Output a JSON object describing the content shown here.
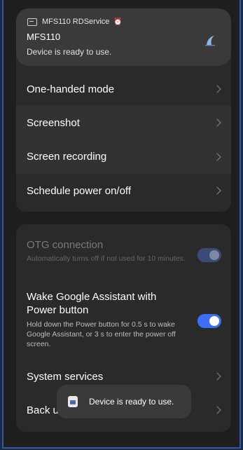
{
  "notification": {
    "app_name": "MFS110 RDService",
    "title": "MFS110",
    "message": "Device is ready to use."
  },
  "card1": {
    "items": [
      {
        "label": "One-handed mode"
      },
      {
        "label": "Screenshot"
      },
      {
        "label": "Screen recording"
      },
      {
        "label": "Schedule power on/off"
      }
    ]
  },
  "card2": {
    "otg": {
      "label": "OTG connection",
      "description": "Automatically turns off if not used for 10 minutes.",
      "enabled": true
    },
    "assistant": {
      "label": "Wake Google Assistant with Power button",
      "description": "Hold down the Power button for 0.5 s to wake Google Assistant, or 3 s to enter the power off screen.",
      "enabled": true
    },
    "system_services": {
      "label": "System services"
    },
    "back_up": {
      "label": "Back u"
    }
  },
  "toast": {
    "message": "Device is ready to use."
  },
  "colors": {
    "background": "#1e1e1e",
    "card": "#2a2a2a",
    "toggle_on": "#3d6ef5",
    "frame_border": "#3a56a0"
  }
}
